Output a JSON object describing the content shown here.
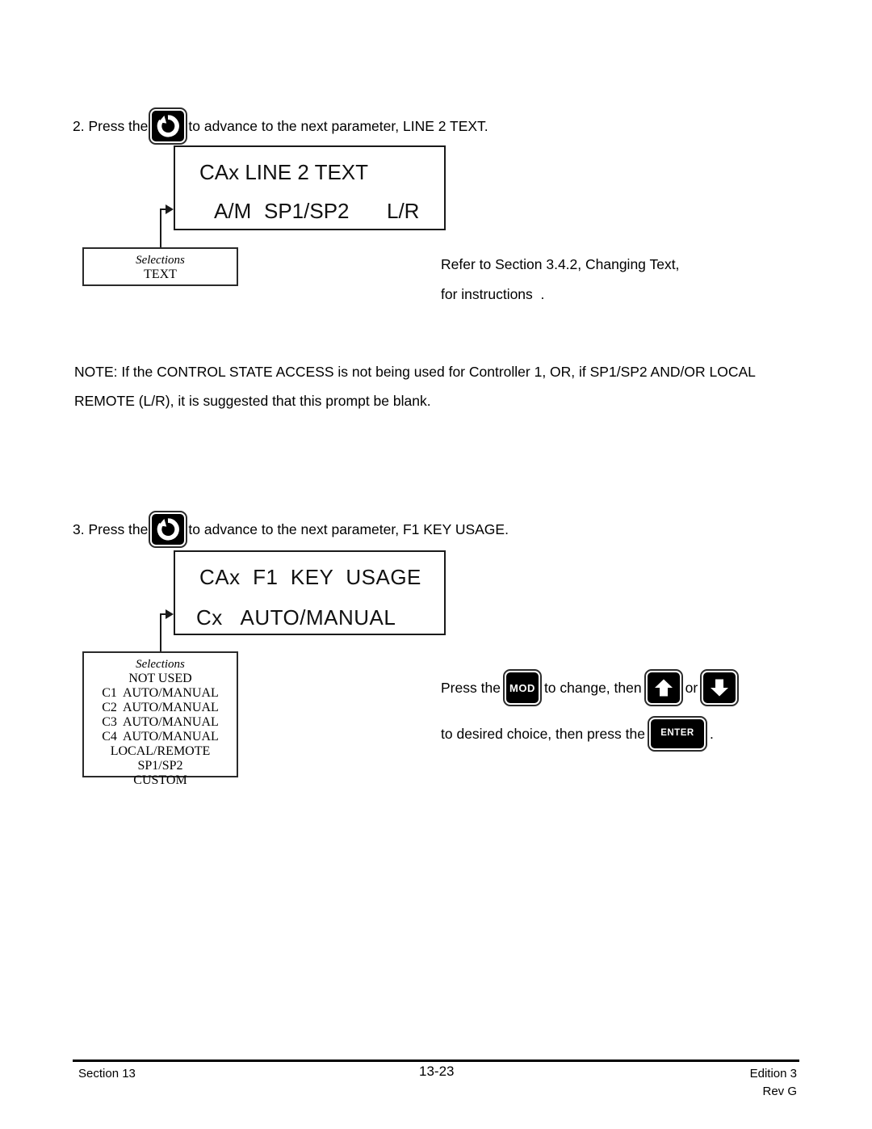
{
  "document": {
    "page_number": "13-23",
    "section_label": "Section 13",
    "edition": "Edition 3",
    "revision": "Rev G"
  },
  "steps": [
    {
      "number": "2. Press the",
      "key_icon": "advance-loop-icon",
      "tail": "to advance to the next parameter, LINE 2 TEXT."
    },
    {
      "number": "3. Press the",
      "key_icon": "advance-loop-icon",
      "tail": "to advance to the next parameter, F1 KEY USAGE."
    }
  ],
  "display_line2text": {
    "line1": "CAx LINE 2 TEXT",
    "line2_col1": "A/M",
    "line2_col2": "SP1/SP2",
    "line2_col3": "L/R"
  },
  "display_f1key": {
    "line1": "CAx  F1  KEY  USAGE",
    "line2": "Cx   AUTO/MANUAL"
  },
  "selections_text": {
    "title": "Selections",
    "items": [
      "TEXT"
    ]
  },
  "selections_f1key": {
    "title": "Selections",
    "items": [
      "NOT USED",
      "C1  AUTO/MANUAL",
      "C2  AUTO/MANUAL",
      "C3  AUTO/MANUAL",
      "C4  AUTO/MANUAL",
      "LOCAL/REMOTE",
      "SP1/SP2",
      "CUSTOM"
    ]
  },
  "refer_note": {
    "line1": "Refer to Section 3.4.2, Changing Text,",
    "line2": "for instructions  ."
  },
  "note_paragraph": {
    "line1": "NOTE: If the CONTROL STATE ACCESS is not being used for Controller 1, OR, if SP1/SP2 AND/OR LOCAL",
    "line2": "REMOTE (L/R), it is suggested that this prompt be blank."
  },
  "change_instructions": {
    "press_the": "Press the",
    "mod_label": "MOD",
    "to_change_then": "to change, then",
    "or": "or",
    "to_desired": "to desired choice, then press the",
    "enter_label": "ENTER",
    "period": "."
  }
}
